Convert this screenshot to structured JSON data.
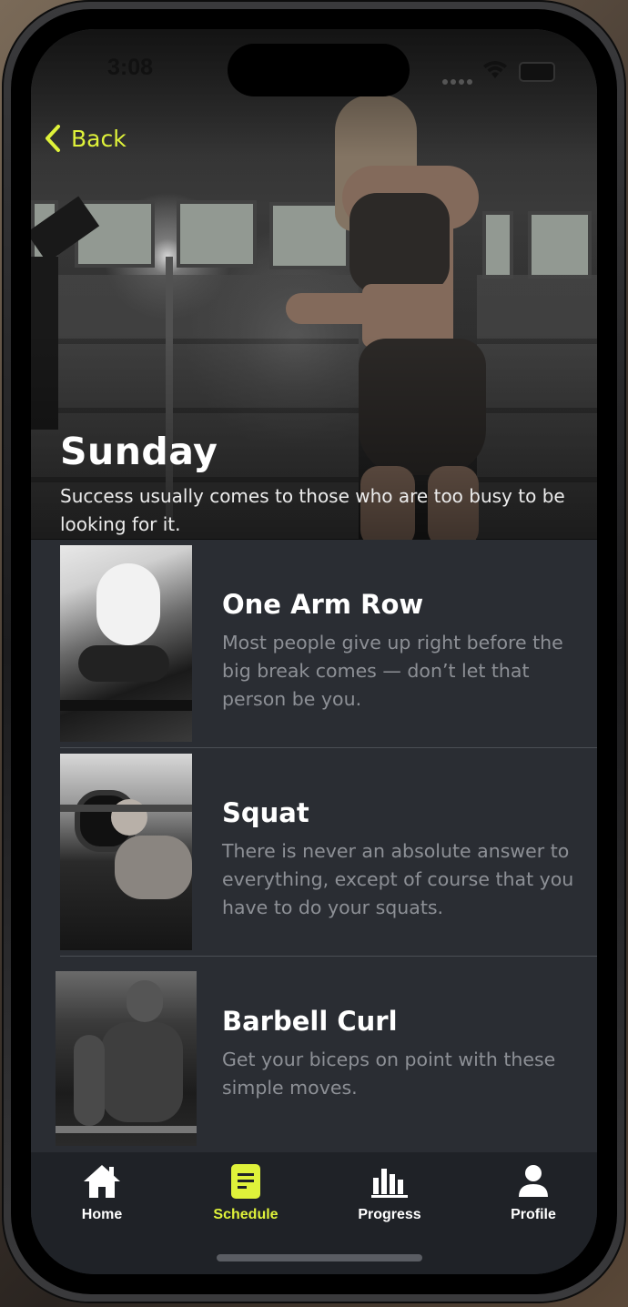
{
  "status": {
    "time": "3:08"
  },
  "nav": {
    "back_label": "Back"
  },
  "hero": {
    "title": "Sunday",
    "quote": "Success usually comes to those who are too busy to be looking for it."
  },
  "workouts": [
    {
      "name": "One Arm Row",
      "description": "Most people give up right before the big break comes — don’t let that person be you."
    },
    {
      "name": "Squat",
      "description": "There is never an absolute answer to everything, except of course that you have to do your squats."
    },
    {
      "name": "Barbell Curl",
      "description": "Get your biceps on point with these simple moves."
    }
  ],
  "tabs": [
    {
      "label": "Home",
      "icon": "home-icon",
      "active": false
    },
    {
      "label": "Schedule",
      "icon": "schedule-icon",
      "active": true
    },
    {
      "label": "Progress",
      "icon": "progress-icon",
      "active": false
    },
    {
      "label": "Profile",
      "icon": "profile-icon",
      "active": false
    }
  ],
  "colors": {
    "accent": "#dff23a",
    "background": "#2a2d33",
    "tabbar": "#1f2227",
    "muted_text": "#8d9096"
  }
}
